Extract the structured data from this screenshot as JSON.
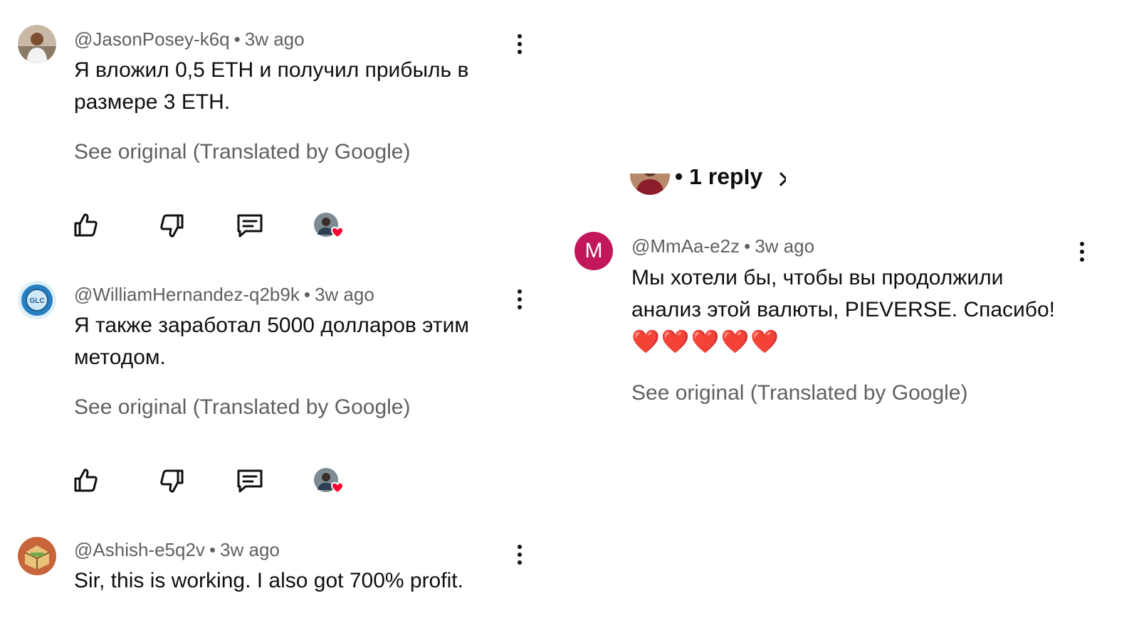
{
  "comments": [
    {
      "handle": "@JasonPosey-k6q",
      "time": "3w ago",
      "text": "Я вложил 0,5 ETH и получил прибыль в размере 3 ETH.",
      "see_original": "See original (Translated by Google)"
    },
    {
      "handle": "@WilliamHernandez-q2b9k",
      "time": "3w ago",
      "text": "Я также заработал 5000 долларов этим методом.",
      "see_original": "See original (Translated by Google)",
      "avatar_text": "GLC"
    },
    {
      "handle": "@Ashish-e5q2v",
      "time": "3w ago",
      "text": "Sir, this is working. I also got 700% profit."
    }
  ],
  "right": {
    "reply_label": "• 1 reply",
    "comment": {
      "avatar_letter": "M",
      "handle": "@MmAa-e2z",
      "time": "3w ago",
      "text": "Мы хотели бы, чтобы вы продолжили анализ этой валюты, PIEVERSE. Спасибо!",
      "hearts": "❤️❤️❤️❤️❤️",
      "see_original": "See original (Translated by Google)"
    }
  },
  "separator": "•",
  "colors": {
    "secondary_text": "#606060",
    "primary_text": "#0f0f0f",
    "heart": "#ff0033",
    "letter_avatar": "#c2185b"
  },
  "icons": [
    "thumb-up-icon",
    "thumb-down-icon",
    "reply-icon",
    "creator-heart-icon",
    "more-vert-icon",
    "chevron-right-icon"
  ]
}
